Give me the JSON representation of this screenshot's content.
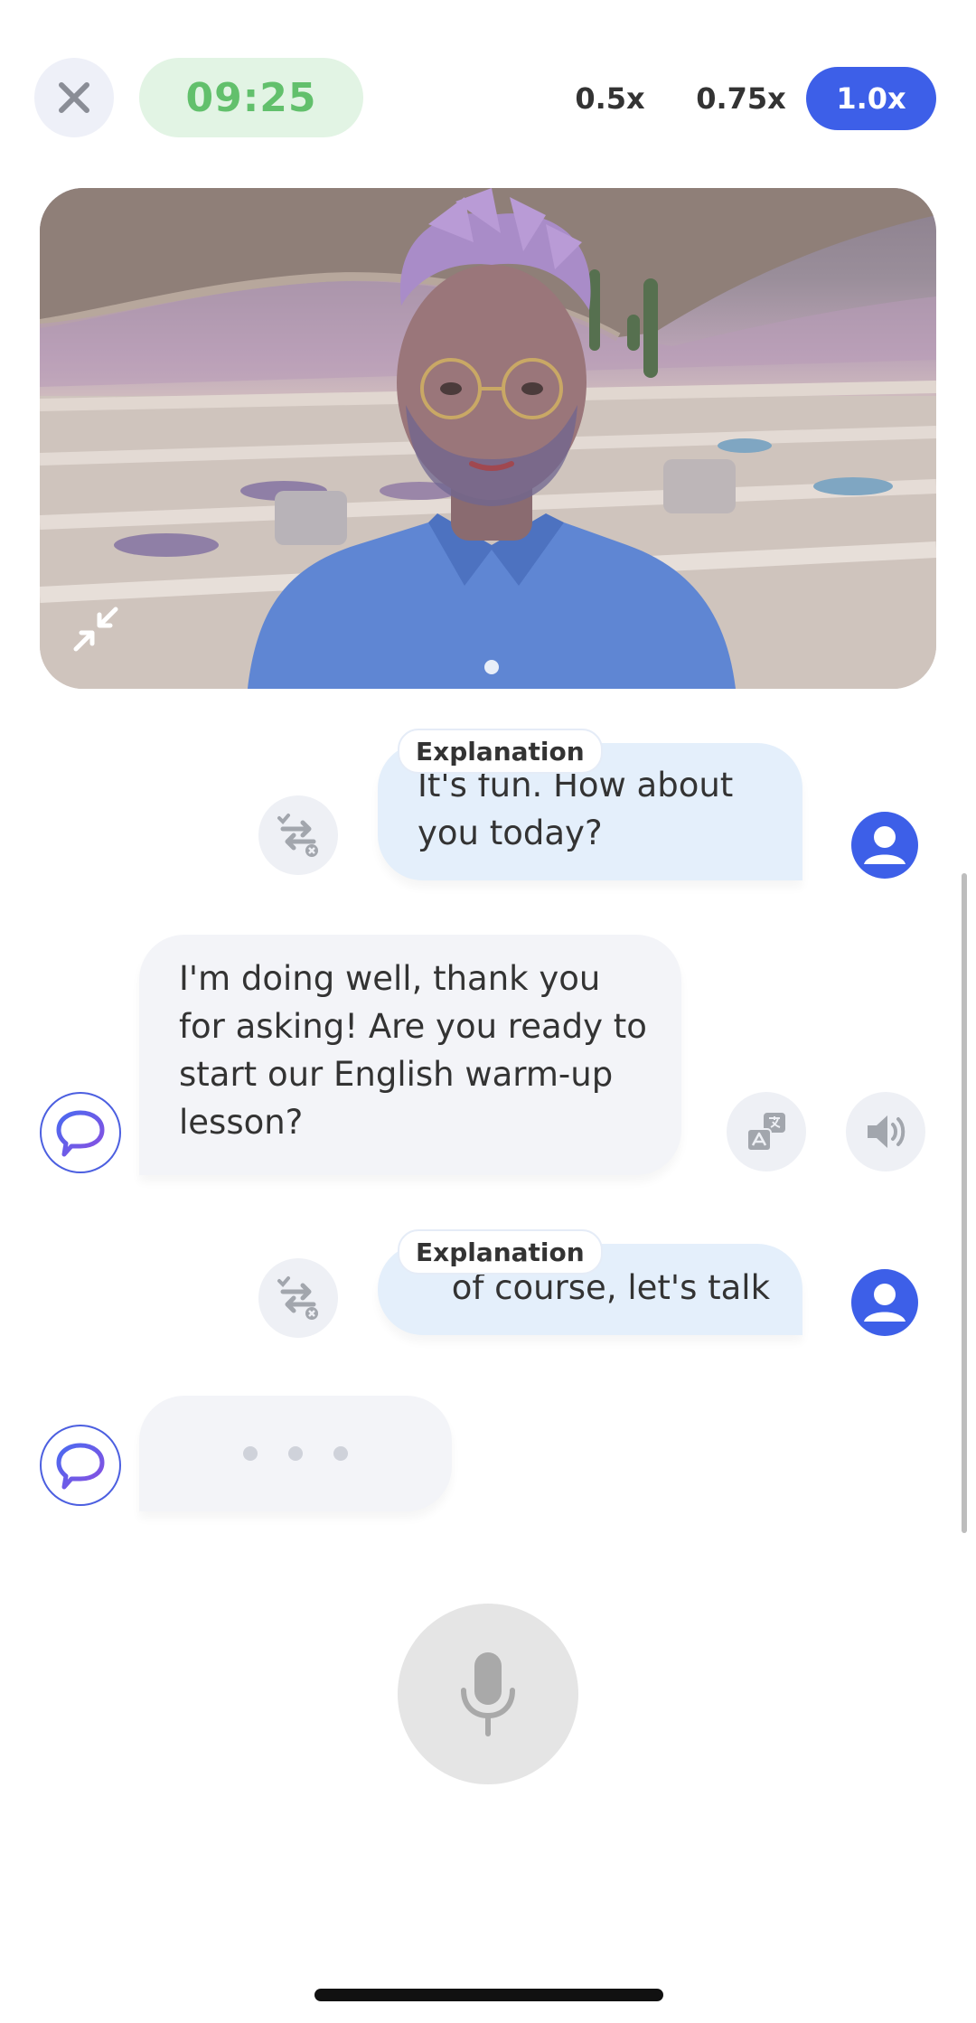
{
  "header": {
    "timer": "09:25",
    "speeds": [
      "0.5x",
      "0.75x",
      "1.0x"
    ],
    "selected_speed": "1.0x"
  },
  "icons": {
    "close": "close-icon",
    "shrink": "collapse-arrows-icon",
    "convert": "swap-check-icon",
    "translate": "translate-icon",
    "speaker": "speaker-icon",
    "mic": "microphone-icon",
    "user": "user-avatar-icon",
    "bot": "chat-bubble-logo-icon"
  },
  "chat": {
    "messages": [
      {
        "sender": "user",
        "tag": "Explanation",
        "text": "It's fun. How about you today?"
      },
      {
        "sender": "bot",
        "text": "I'm doing well, thank you for asking! Are you ready to start our English warm-up lesson?"
      },
      {
        "sender": "user",
        "tag": "Explanation",
        "text": "of course, let's talk"
      },
      {
        "sender": "bot",
        "typing": true
      }
    ]
  },
  "colors": {
    "accent": "#3d5fe8",
    "timer_bg": "#e2f4e4",
    "timer_text": "#62c06c",
    "user_bubble": "#e4effb",
    "bot_bubble": "#f3f4f8"
  }
}
